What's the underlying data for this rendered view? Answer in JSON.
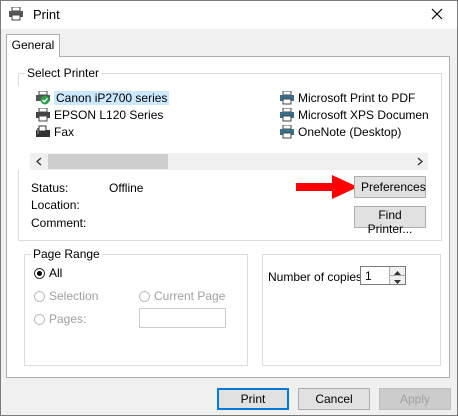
{
  "window": {
    "title": "Print"
  },
  "tabs": [
    {
      "label": "General"
    }
  ],
  "select_printer": {
    "label": "Select Printer",
    "printers": [
      {
        "name": "Canon iP2700 series",
        "icon": "printer-default-icon",
        "selected": true
      },
      {
        "name": "EPSON L120 Series",
        "icon": "printer-icon"
      },
      {
        "name": "Fax",
        "icon": "fax-icon"
      },
      {
        "name": "Microsoft Print to PDF",
        "icon": "printer-icon"
      },
      {
        "name": "Microsoft XPS Documen",
        "icon": "printer-icon"
      },
      {
        "name": "OneNote (Desktop)",
        "icon": "printer-icon"
      }
    ],
    "status_label": "Status:",
    "status_value": "Offline",
    "location_label": "Location:",
    "location_value": "",
    "comment_label": "Comment:",
    "comment_value": "",
    "preferences_button": "Preferences",
    "find_printer_button": "Find Printer..."
  },
  "page_range": {
    "label": "Page Range",
    "all": "All",
    "selection": "Selection",
    "current_page": "Current Page",
    "pages": "Pages:",
    "pages_value": ""
  },
  "copies": {
    "label": "Number of copies:",
    "value": "1"
  },
  "footer": {
    "print_button": "Print",
    "cancel_button": "Cancel",
    "apply_button": "Apply"
  },
  "colors": {
    "annotation_arrow": "#ff0000",
    "selection_highlight": "#cce8ff",
    "default_button_border": "#0078d7"
  }
}
